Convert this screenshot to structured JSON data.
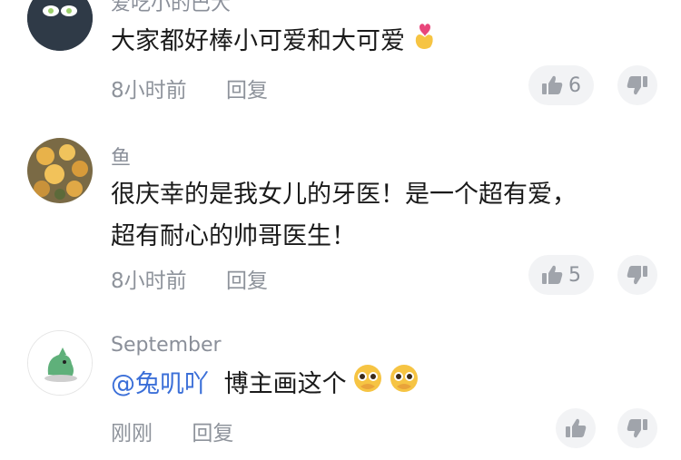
{
  "colors": {
    "text": "#1a1a1a",
    "muted": "#8e939b",
    "mention": "#3b6fd8",
    "button_bg": "#f2f3f5"
  },
  "comments": [
    {
      "username": "爱吃小的巴大",
      "text": "大家都好棒小可爱和大可爱",
      "emoji": "heart-hand-emoji",
      "time": "8小时前",
      "reply": "回复",
      "likes": "6"
    },
    {
      "username": "鱼",
      "lines": [
        "很庆幸的是我女儿的牙医！是一个超有爱，",
        "超有耐心的帅哥医生！"
      ],
      "time": "8小时前",
      "reply": "回复",
      "likes": "5"
    },
    {
      "username": "September",
      "mention": "@兔叽吖",
      "text": "博主画这个",
      "emoji": "pleading-face-emoji",
      "time": "刚刚",
      "reply": "回复"
    }
  ]
}
